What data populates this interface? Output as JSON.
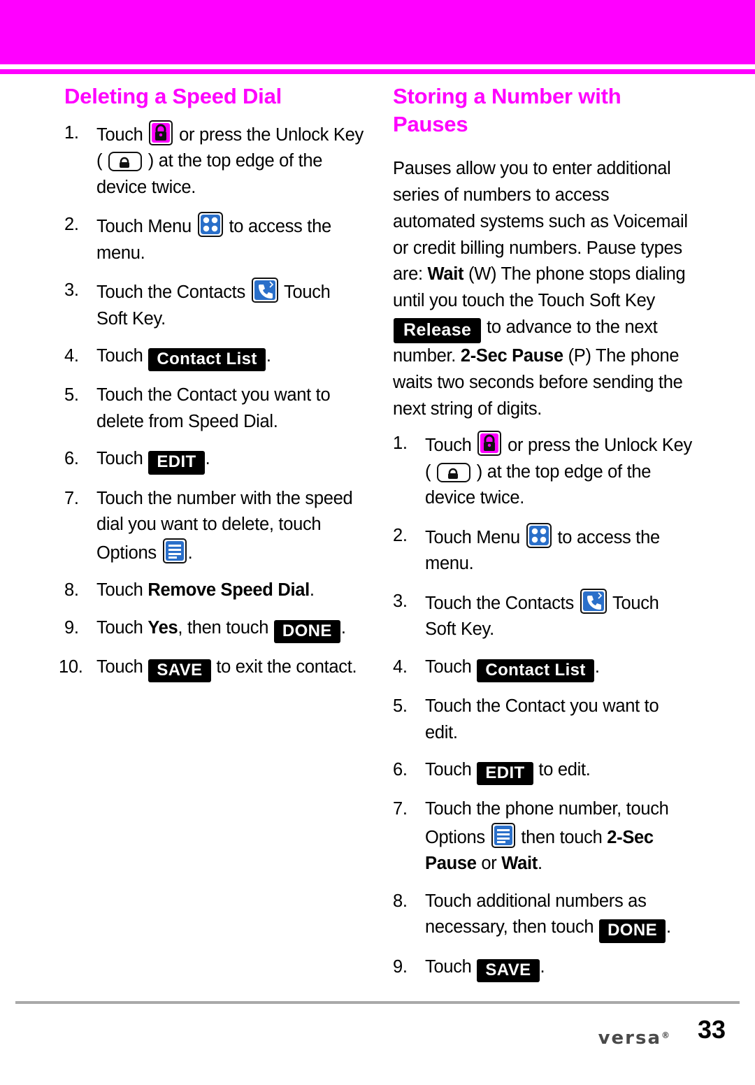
{
  "page": {
    "number": "33",
    "brand": "versa",
    "brand_tm": "®",
    "accent_color": "#ff00ff",
    "rule_color": "#a9a9a9"
  },
  "left_column": {
    "title": "Deleting a Speed Dial",
    "steps": [
      {
        "num": "1.",
        "parts": [
          {
            "t": "text",
            "v": "Touch "
          },
          {
            "t": "icon",
            "v": "lock-icon"
          },
          {
            "t": "text",
            "v": " or press the Unlock Key ( "
          },
          {
            "t": "icon",
            "v": "unlock-key-icon"
          },
          {
            "t": "text",
            "v": " ) at the top edge of the device twice."
          }
        ]
      },
      {
        "num": "2.",
        "parts": [
          {
            "t": "text",
            "v": "Touch Menu "
          },
          {
            "t": "icon",
            "v": "menu-grid-icon"
          },
          {
            "t": "text",
            "v": " to access the menu."
          }
        ]
      },
      {
        "num": "3.",
        "parts": [
          {
            "t": "text",
            "v": "Touch the Contacts "
          },
          {
            "t": "icon",
            "v": "contacts-icon"
          },
          {
            "t": "text",
            "v": " Touch Soft Key."
          }
        ]
      },
      {
        "num": "4.",
        "parts": [
          {
            "t": "text",
            "v": "Touch "
          },
          {
            "t": "chip",
            "v": "Contact List"
          },
          {
            "t": "text",
            "v": "."
          }
        ]
      },
      {
        "num": "5.",
        "parts": [
          {
            "t": "text",
            "v": "Touch the Contact you want to delete from Speed Dial."
          }
        ]
      },
      {
        "num": "6.",
        "parts": [
          {
            "t": "text",
            "v": "Touch "
          },
          {
            "t": "chip",
            "v": "EDIT"
          },
          {
            "t": "text",
            "v": "."
          }
        ]
      },
      {
        "num": "7.",
        "parts": [
          {
            "t": "text",
            "v": "Touch the number with the speed dial you want to delete, touch Options "
          },
          {
            "t": "icon",
            "v": "options-list-icon"
          },
          {
            "t": "text",
            "v": "."
          }
        ]
      },
      {
        "num": "8.",
        "parts": [
          {
            "t": "text",
            "v": "Touch "
          },
          {
            "t": "bold",
            "v": "Remove Speed Dial"
          },
          {
            "t": "text",
            "v": "."
          }
        ]
      },
      {
        "num": "9.",
        "parts": [
          {
            "t": "text",
            "v": "Touch "
          },
          {
            "t": "bold",
            "v": "Yes"
          },
          {
            "t": "text",
            "v": ", then touch "
          },
          {
            "t": "chip",
            "v": "DONE"
          },
          {
            "t": "text",
            "v": "."
          }
        ]
      },
      {
        "num": "10.",
        "parts": [
          {
            "t": "text",
            "v": "Touch "
          },
          {
            "t": "chip",
            "v": "SAVE"
          },
          {
            "t": "text",
            "v": " to exit the contact."
          }
        ]
      }
    ]
  },
  "right_column": {
    "title": "Storing a Number with Pauses",
    "intro": [
      {
        "t": "text",
        "v": "Pauses allow you to enter additional series of numbers to access automated systems such as Voicemail or credit billing numbers. Pause types are: "
      },
      {
        "t": "bold",
        "v": "Wait"
      },
      {
        "t": "text",
        "v": " (W) The phone stops dialing until you touch the Touch Soft Key "
      },
      {
        "t": "chip-release",
        "v": "Release"
      },
      {
        "t": "text",
        "v": " to advance to the next number. "
      },
      {
        "t": "bold",
        "v": "2-Sec Pause"
      },
      {
        "t": "text",
        "v": " (P) The phone waits two seconds before sending the next string of digits."
      }
    ],
    "steps": [
      {
        "num": "1.",
        "parts": [
          {
            "t": "text",
            "v": "Touch "
          },
          {
            "t": "icon",
            "v": "lock-icon"
          },
          {
            "t": "text",
            "v": " or press the Unlock Key ( "
          },
          {
            "t": "icon",
            "v": "unlock-key-icon"
          },
          {
            "t": "text",
            "v": " ) at the top edge of the device twice."
          }
        ]
      },
      {
        "num": "2.",
        "parts": [
          {
            "t": "text",
            "v": "Touch Menu "
          },
          {
            "t": "icon",
            "v": "menu-grid-icon"
          },
          {
            "t": "text",
            "v": " to access the menu."
          }
        ]
      },
      {
        "num": "3.",
        "parts": [
          {
            "t": "text",
            "v": "Touch the Contacts "
          },
          {
            "t": "icon",
            "v": "contacts-icon"
          },
          {
            "t": "text",
            "v": " Touch Soft Key."
          }
        ]
      },
      {
        "num": "4.",
        "parts": [
          {
            "t": "text",
            "v": "Touch "
          },
          {
            "t": "chip",
            "v": "Contact List"
          },
          {
            "t": "text",
            "v": "."
          }
        ]
      },
      {
        "num": "5.",
        "parts": [
          {
            "t": "text",
            "v": "Touch the Contact you want to edit."
          }
        ]
      },
      {
        "num": "6.",
        "parts": [
          {
            "t": "text",
            "v": "Touch "
          },
          {
            "t": "chip",
            "v": "EDIT"
          },
          {
            "t": "text",
            "v": " to edit."
          }
        ]
      },
      {
        "num": "7.",
        "parts": [
          {
            "t": "text",
            "v": "Touch the phone number, touch Options "
          },
          {
            "t": "icon",
            "v": "options-list-icon"
          },
          {
            "t": "text",
            "v": " then touch "
          },
          {
            "t": "bold",
            "v": "2-Sec Pause"
          },
          {
            "t": "text",
            "v": " or "
          },
          {
            "t": "bold",
            "v": "Wait"
          },
          {
            "t": "text",
            "v": "."
          }
        ]
      },
      {
        "num": "8.",
        "parts": [
          {
            "t": "text",
            "v": "Touch additional numbers as necessary, then touch "
          },
          {
            "t": "chip",
            "v": "DONE"
          },
          {
            "t": "text",
            "v": "."
          }
        ]
      },
      {
        "num": "9.",
        "parts": [
          {
            "t": "text",
            "v": "Touch "
          },
          {
            "t": "chip",
            "v": "SAVE"
          },
          {
            "t": "text",
            "v": "."
          }
        ]
      }
    ]
  }
}
